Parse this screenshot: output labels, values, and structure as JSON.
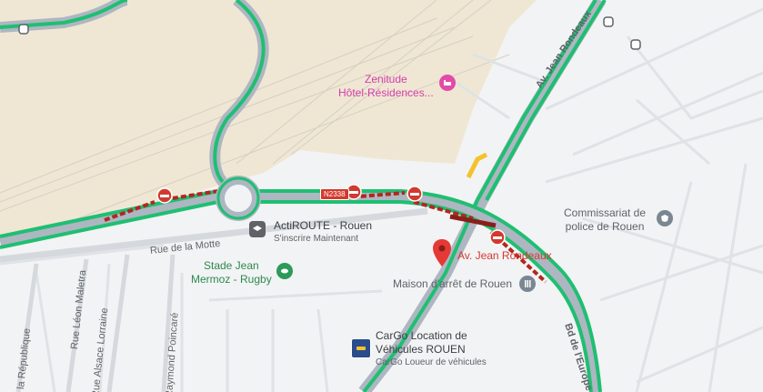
{
  "map": {
    "streets": {
      "av_jean_rondeaux_top": "Av. Jean Rondeaux",
      "rue_de_la_motte": "Rue de la Motte",
      "rue_leon_maletra": "Rue Léon Maletra",
      "rue_alsace_lorraine": "Rue Alsace Lorraine",
      "raymond_poincare": "Raymond Poincaré",
      "la_republique": "e la République",
      "bd_europe": "Bd de l'Europe",
      "route_shield": "N2338"
    },
    "pois": {
      "zenitude": {
        "line1": "Zenitude",
        "line2": "Hôtel-Résidences..."
      },
      "actiroute": {
        "name": "ActiROUTE - Rouen",
        "subtitle": "S'inscrire Maintenant"
      },
      "stade": {
        "line1": "Stade Jean",
        "line2": "Mermoz - Rugby"
      },
      "commissariat": {
        "line1": "Commissariat de",
        "line2": "police de Rouen"
      },
      "maison_arret": {
        "name": "Maison d'arrêt de Rouen"
      },
      "cargo": {
        "line1": "CarGo Location de",
        "line2": "Véhicules ROUEN",
        "subtitle": "CarGo Loueur de véhicules"
      },
      "selected_place": {
        "name": "Av. Jean Rondeaux"
      }
    },
    "colors": {
      "traffic_green": "#1fbf72",
      "traffic_red": "#b3261e",
      "traffic_yellow": "#f4c22b",
      "rail_area": "#efe7d4",
      "road_gray": "#aeb6c2"
    }
  }
}
